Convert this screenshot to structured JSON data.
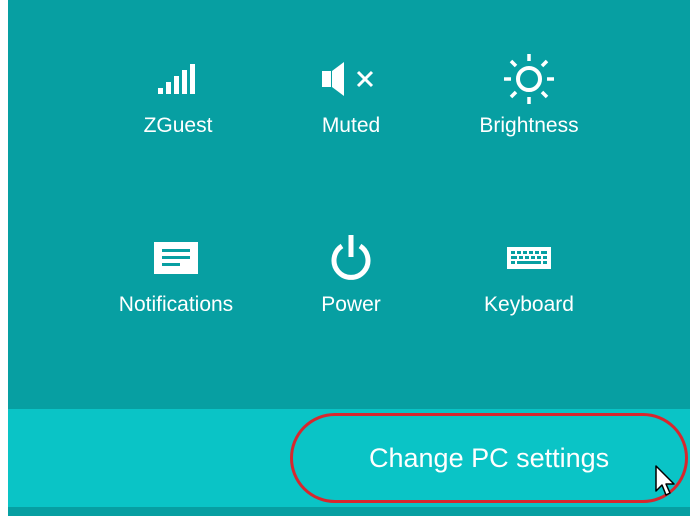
{
  "settings_pane": {
    "tiles": [
      {
        "id": "network",
        "label": "ZGuest",
        "icon": "signal-bars-icon"
      },
      {
        "id": "volume",
        "label": "Muted",
        "icon": "speaker-muted-icon"
      },
      {
        "id": "brightness",
        "label": "Brightness",
        "icon": "sun-icon"
      },
      {
        "id": "notifications",
        "label": "Notifications",
        "icon": "notifications-icon"
      },
      {
        "id": "power",
        "label": "Power",
        "icon": "power-icon"
      },
      {
        "id": "keyboard",
        "label": "Keyboard",
        "icon": "keyboard-icon"
      }
    ],
    "change_pc_settings_label": "Change PC settings"
  },
  "colors": {
    "panel_background": "#079fa2",
    "bottom_bar": "#0ac4c6",
    "highlight_outline": "#d7272e",
    "text": "#ffffff"
  }
}
